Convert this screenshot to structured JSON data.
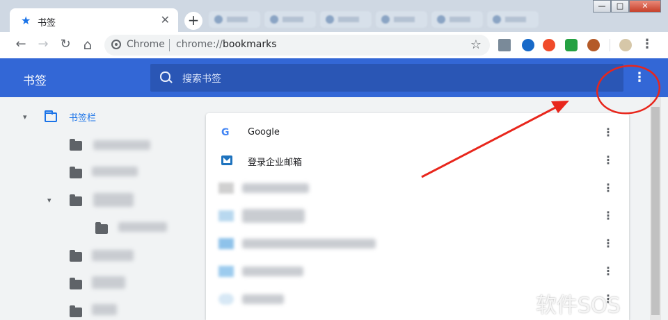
{
  "window": {
    "minimize_glyph": "—",
    "maximize_glyph": "□",
    "close_glyph": "✕"
  },
  "tab": {
    "title": "书签",
    "close_glyph": "✕",
    "new_tab_glyph": "+"
  },
  "toolbar": {
    "back_glyph": "←",
    "forward_glyph": "→",
    "reload_glyph": "↻",
    "home_glyph": "⌂",
    "omnibox_origin": "Chrome",
    "url_scheme": "chrome://",
    "url_path": "bookmarks",
    "star_glyph": "☆",
    "menu_glyph": "⋮"
  },
  "bookmarks_header": {
    "title": "书签",
    "search_placeholder": "搜索书签",
    "menu_glyph": "⋮"
  },
  "tree": {
    "root_label": "书签栏",
    "arrow_glyph": "▾"
  },
  "list": {
    "items": [
      {
        "title": "Google",
        "icon": "google-icon"
      },
      {
        "title": "登录企业邮箱",
        "icon": "mail-icon"
      }
    ],
    "more_glyph": "⋮"
  },
  "watermark": {
    "text": "软件SOS"
  },
  "colors": {
    "header_blue": "#3367d6",
    "search_blue": "#2a56b5",
    "accent": "#1a73e8",
    "annotation_red": "#e8261c"
  }
}
